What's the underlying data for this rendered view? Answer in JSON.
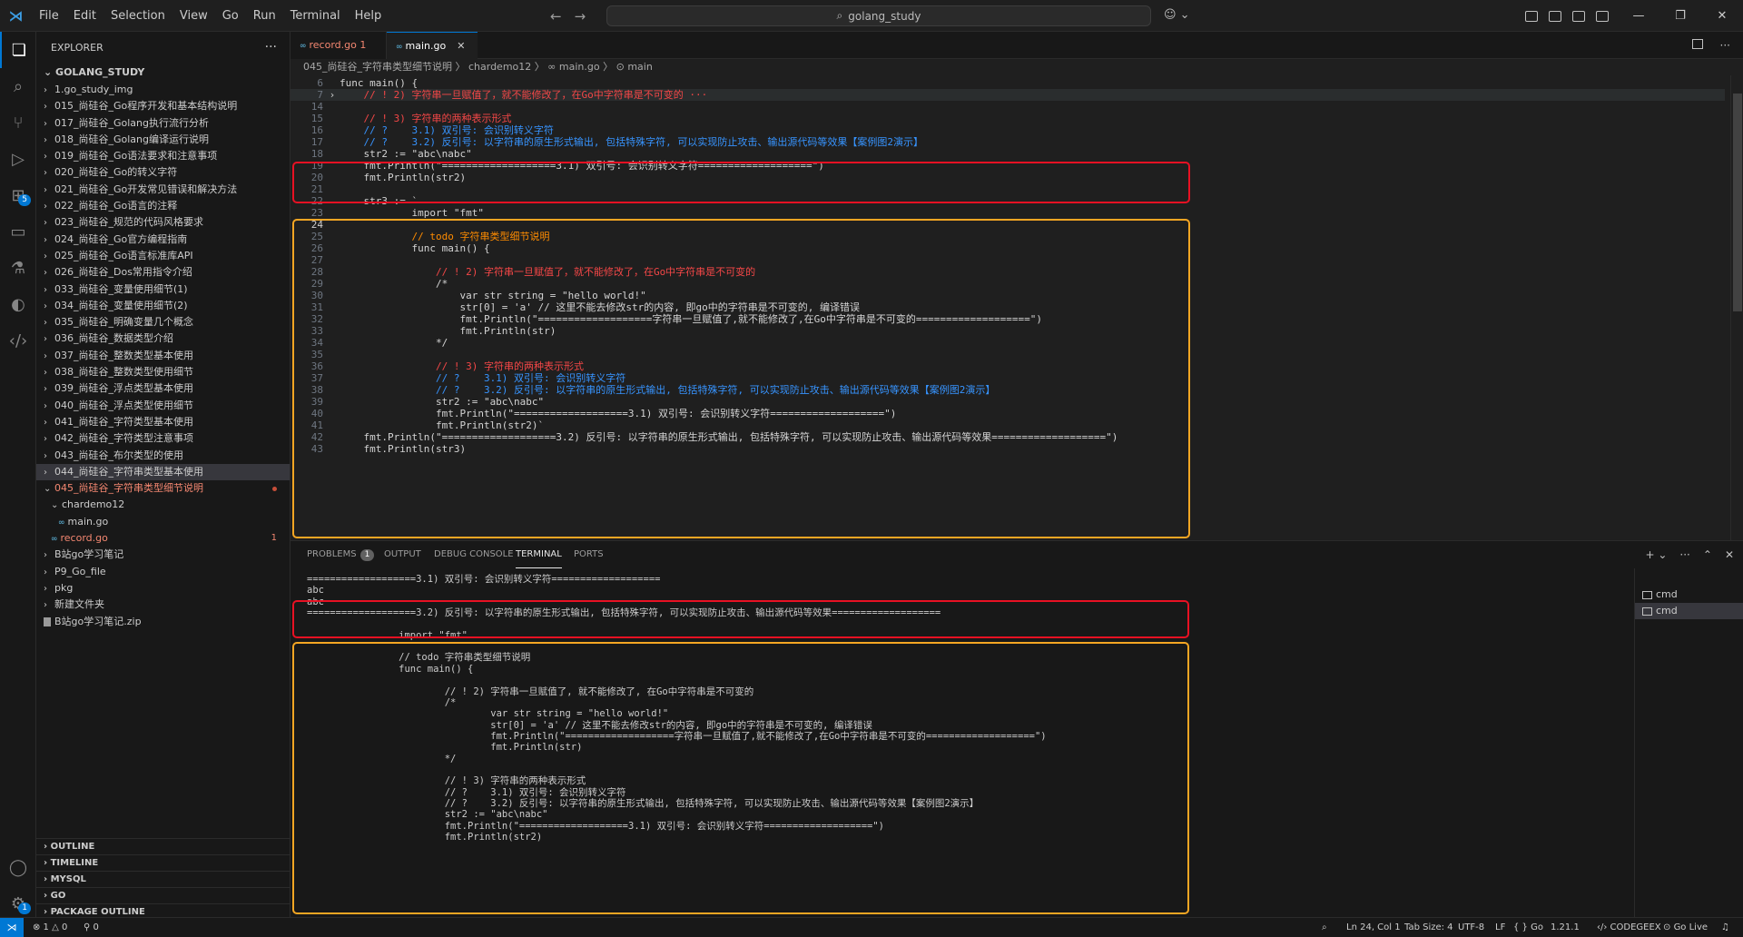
{
  "titlebar": {
    "menu": [
      "File",
      "Edit",
      "Selection",
      "View",
      "Go",
      "Run",
      "Terminal",
      "Help"
    ],
    "search": "golang_study"
  },
  "activity": {
    "extensions_badge": "5",
    "settings_badge": "1"
  },
  "sidebar": {
    "title": "EXPLORER",
    "more": "···",
    "project": "GOLANG_STUDY",
    "items": [
      {
        "label": "1.go_study_img",
        "type": "folder",
        "depth": 1
      },
      {
        "label": "015_尚硅谷_Go程序开发和基本结构说明",
        "type": "folder",
        "depth": 1
      },
      {
        "label": "017_尚硅谷_Golang执行流行分析",
        "type": "folder",
        "depth": 1
      },
      {
        "label": "018_尚硅谷_Golang编译运行说明",
        "type": "folder",
        "depth": 1
      },
      {
        "label": "019_尚硅谷_Go语法要求和注意事项",
        "type": "folder",
        "depth": 1
      },
      {
        "label": "020_尚硅谷_Go的转义字符",
        "type": "folder",
        "depth": 1
      },
      {
        "label": "021_尚硅谷_Go开发常见错误和解决方法",
        "type": "folder",
        "depth": 1
      },
      {
        "label": "022_尚硅谷_Go语言的注释",
        "type": "folder",
        "depth": 1
      },
      {
        "label": "023_尚硅谷_规范的代码风格要求",
        "type": "folder",
        "depth": 1
      },
      {
        "label": "024_尚硅谷_Go官方编程指南",
        "type": "folder",
        "depth": 1
      },
      {
        "label": "025_尚硅谷_Go语言标准库API",
        "type": "folder",
        "depth": 1
      },
      {
        "label": "026_尚硅谷_Dos常用指令介绍",
        "type": "folder",
        "depth": 1
      },
      {
        "label": "033_尚硅谷_变量使用细节(1)",
        "type": "folder",
        "depth": 1
      },
      {
        "label": "034_尚硅谷_变量使用细节(2)",
        "type": "folder",
        "depth": 1
      },
      {
        "label": "035_尚硅谷_明确变量几个概念",
        "type": "folder",
        "depth": 1
      },
      {
        "label": "036_尚硅谷_数据类型介绍",
        "type": "folder",
        "depth": 1
      },
      {
        "label": "037_尚硅谷_整数类型基本使用",
        "type": "folder",
        "depth": 1
      },
      {
        "label": "038_尚硅谷_整数类型使用细节",
        "type": "folder",
        "depth": 1
      },
      {
        "label": "039_尚硅谷_浮点类型基本使用",
        "type": "folder",
        "depth": 1
      },
      {
        "label": "040_尚硅谷_浮点类型使用细节",
        "type": "folder",
        "depth": 1
      },
      {
        "label": "041_尚硅谷_字符类型基本使用",
        "type": "folder",
        "depth": 1
      },
      {
        "label": "042_尚硅谷_字符类型注意事项",
        "type": "folder",
        "depth": 1
      },
      {
        "label": "043_尚硅谷_布尔类型的使用",
        "type": "folder",
        "depth": 1
      },
      {
        "label": "044_尚硅谷_字符串类型基本使用",
        "type": "folder",
        "depth": 1,
        "selected": true
      },
      {
        "label": "045_尚硅谷_字符串类型细节说明",
        "type": "folder-open",
        "depth": 1,
        "red": true,
        "dot": true
      },
      {
        "label": "chardemo12",
        "type": "folder-open",
        "depth": 2
      },
      {
        "label": "main.go",
        "type": "go",
        "depth": 3
      },
      {
        "label": "record.go",
        "type": "go",
        "depth": 2,
        "red": true,
        "num": "1"
      },
      {
        "label": "B站go学习笔记",
        "type": "folder",
        "depth": 1
      },
      {
        "label": "P9_Go_file",
        "type": "folder",
        "depth": 1
      },
      {
        "label": "pkg",
        "type": "folder",
        "depth": 1
      },
      {
        "label": "新建文件夹",
        "type": "folder",
        "depth": 1
      },
      {
        "label": "B站go学习笔记.zip",
        "type": "zip",
        "depth": 1
      }
    ],
    "sections": [
      "OUTLINE",
      "TIMELINE",
      "MYSQL",
      "GO",
      "PACKAGE OUTLINE"
    ]
  },
  "tabs": [
    {
      "label": "record.go",
      "badge": "1",
      "active": false
    },
    {
      "label": "main.go",
      "active": true
    }
  ],
  "breadcrumb": "045_尚硅谷_字符串类型细节说明  〉 chardemo12  〉 ∞ main.go  〉 ⊙ main",
  "editor": {
    "lines": [
      {
        "n": "6",
        "t": "func main() {",
        "cls": "c-txt"
      },
      {
        "n": "7",
        "t": "    // ! 2) 字符串一旦赋值了，就不能修改了，在Go中字符串是不可变的 ···",
        "cls": "c-red",
        "fold": true
      },
      {
        "n": "14",
        "t": "",
        "cls": "c-txt"
      },
      {
        "n": "15",
        "t": "    // ! 3) 字符串的两种表示形式",
        "cls": "c-red"
      },
      {
        "n": "16",
        "t": "    // ?    3.1) 双引号: 会识别转义字符",
        "cls": "c-blue"
      },
      {
        "n": "17",
        "t": "    // ?    3.2) 反引号: 以字符串的原生形式输出, 包括特殊字符, 可以实现防止攻击、输出源代码等效果【案例图2演示】",
        "cls": "c-blue"
      },
      {
        "n": "18",
        "t": "    str2 := \"abc\\nabc\"",
        "cls": "c-txt"
      },
      {
        "n": "19",
        "t": "    fmt.Println(\"===================3.1) 双引号: 会识别转义字符===================\")",
        "cls": "c-txt"
      },
      {
        "n": "20",
        "t": "    fmt.Println(str2)",
        "cls": "c-txt"
      },
      {
        "n": "21",
        "t": "",
        "cls": "c-txt"
      },
      {
        "n": "22",
        "t": "    str3 := `",
        "cls": "c-txt"
      },
      {
        "n": "23",
        "t": "            import \"fmt\"",
        "cls": "c-txt"
      },
      {
        "n": "24",
        "t": "",
        "cls": "c-txt",
        "cur": true
      },
      {
        "n": "25",
        "t": "            // todo 字符串类型细节说明",
        "cls": "c-orange"
      },
      {
        "n": "26",
        "t": "            func main() {",
        "cls": "c-txt"
      },
      {
        "n": "27",
        "t": "",
        "cls": "c-txt"
      },
      {
        "n": "28",
        "t": "                // ! 2) 字符串一旦赋值了，就不能修改了，在Go中字符串是不可变的",
        "cls": "c-red"
      },
      {
        "n": "29",
        "t": "                /*",
        "cls": "c-txt"
      },
      {
        "n": "30",
        "t": "                    var str string = \"hello world!\"",
        "cls": "c-txt"
      },
      {
        "n": "31",
        "t": "                    str[0] = 'a' // 这里不能去修改str的内容, 即go中的字符串是不可变的, 编译错误",
        "cls": "c-txt"
      },
      {
        "n": "32",
        "t": "                    fmt.Println(\"===================字符串一旦赋值了,就不能修改了,在Go中字符串是不可变的===================\")",
        "cls": "c-txt"
      },
      {
        "n": "33",
        "t": "                    fmt.Println(str)",
        "cls": "c-txt"
      },
      {
        "n": "34",
        "t": "                */",
        "cls": "c-txt"
      },
      {
        "n": "35",
        "t": "",
        "cls": "c-txt"
      },
      {
        "n": "36",
        "t": "                // ! 3) 字符串的两种表示形式",
        "cls": "c-red"
      },
      {
        "n": "37",
        "t": "                // ?    3.1) 双引号: 会识别转义字符",
        "cls": "c-blue"
      },
      {
        "n": "38",
        "t": "                // ?    3.2) 反引号: 以字符串的原生形式输出, 包括特殊字符, 可以实现防止攻击、输出源代码等效果【案例图2演示】",
        "cls": "c-blue"
      },
      {
        "n": "39",
        "t": "                str2 := \"abc\\nabc\"",
        "cls": "c-txt"
      },
      {
        "n": "40",
        "t": "                fmt.Println(\"===================3.1) 双引号: 会识别转义字符===================\")",
        "cls": "c-txt"
      },
      {
        "n": "41",
        "t": "                fmt.Println(str2)`",
        "cls": "c-txt"
      },
      {
        "n": "42",
        "t": "    fmt.Println(\"===================3.2) 反引号: 以字符串的原生形式输出, 包括特殊字符, 可以实现防止攻击、输出源代码等效果===================\")",
        "cls": "c-txt"
      },
      {
        "n": "43",
        "t": "    fmt.Println(str3)",
        "cls": "c-txt"
      }
    ]
  },
  "panel": {
    "tabs": [
      "PROBLEMS",
      "OUTPUT",
      "DEBUG CONSOLE",
      "TERMINAL",
      "PORTS"
    ],
    "problems_count": "1",
    "terminals": [
      "cmd",
      "cmd"
    ],
    "terminal_lines": [
      "===================3.1) 双引号: 会识别转义字符===================",
      "abc",
      "abc",
      "===================3.2) 反引号: 以字符串的原生形式输出, 包括特殊字符, 可以实现防止攻击、输出源代码等效果===================",
      "",
      "                import \"fmt\"",
      "",
      "                // todo 字符串类型细节说明",
      "                func main() {",
      "",
      "                        // ! 2) 字符串一旦赋值了, 就不能修改了, 在Go中字符串是不可变的",
      "                        /*",
      "                                var str string = \"hello world!\"",
      "                                str[0] = 'a' // 这里不能去修改str的内容, 即go中的字符串是不可变的, 编译错误",
      "                                fmt.Println(\"===================字符串一旦赋值了,就不能修改了,在Go中字符串是不可变的===================\")",
      "                                fmt.Println(str)",
      "                        */",
      "",
      "                        // ! 3) 字符串的两种表示形式",
      "                        // ?    3.1) 双引号: 会识别转义字符",
      "                        // ?    3.2) 反引号: 以字符串的原生形式输出, 包括特殊字符, 可以实现防止攻击、输出源代码等效果【案例图2演示】",
      "                        str2 := \"abc\\nabc\"",
      "                        fmt.Println(\"===================3.1) 双引号: 会识别转义字符===================\")",
      "                        fmt.Println(str2)"
    ]
  },
  "statusbar": {
    "errors": "⊗ 1 △ 0",
    "ports": "⚲ 0",
    "position": "Ln 24, Col 1",
    "tabsize": "Tab Size: 4",
    "encoding": "UTF-8",
    "eol": "LF",
    "lang": "{ } Go",
    "version": "1.21.1",
    "codegeex": "CODEGEEX",
    "golive": "Go Live"
  },
  "colors": {
    "red_box": "#e81123",
    "orange_box": "#f5a623",
    "accent": "#0078d4"
  }
}
